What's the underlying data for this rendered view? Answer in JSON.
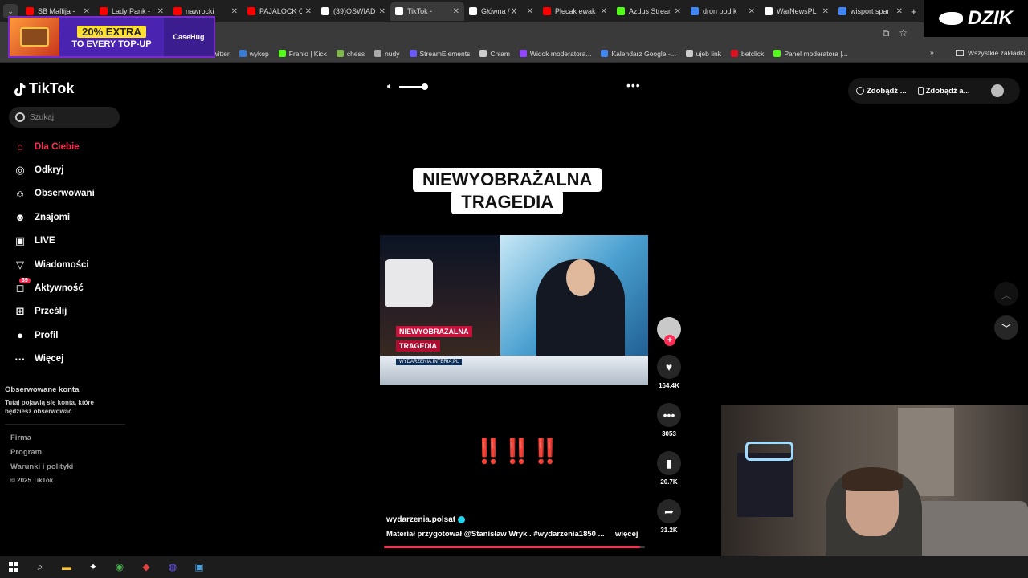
{
  "browser": {
    "tabs": [
      {
        "title": "SB Maffija -",
        "color": "#ff0000",
        "active": false
      },
      {
        "title": "Lady Pank -",
        "color": "#ff0000",
        "active": false
      },
      {
        "title": "nawrocki",
        "color": "#ff0000",
        "active": false
      },
      {
        "title": "PAJALOCK C",
        "color": "#ff0000",
        "active": false
      },
      {
        "title": "(39)OSWIAD",
        "color": "#ffffff",
        "active": false
      },
      {
        "title": "TikTok -",
        "color": "#ffffff",
        "active": true
      },
      {
        "title": "Główna / X",
        "color": "#ffffff",
        "active": false
      },
      {
        "title": "Plecak ewak",
        "color": "#ff0000",
        "active": false
      },
      {
        "title": "Azdus Strear",
        "color": "#53fc18",
        "active": false
      },
      {
        "title": "dron pod k",
        "color": "#4285f4",
        "active": false
      },
      {
        "title": "WarNewsPL",
        "color": "#ffffff",
        "active": false
      },
      {
        "title": "wisport spar",
        "color": "#4285f4",
        "active": false
      }
    ],
    "bookmarks": [
      {
        "label": "twitter",
        "color": "#ffffff"
      },
      {
        "label": "wykop",
        "color": "#3a7bd5"
      },
      {
        "label": "Franio | Kick",
        "color": "#53fc18"
      },
      {
        "label": "chess",
        "color": "#81b64c"
      },
      {
        "label": "nudy",
        "color": "#aaaaaa"
      },
      {
        "label": "StreamElements",
        "color": "#6a5af9"
      },
      {
        "label": "Chłam",
        "color": "#cccccc"
      },
      {
        "label": "Widok moderatora...",
        "color": "#9146ff"
      },
      {
        "label": "Kalendarz Google -...",
        "color": "#4285f4"
      },
      {
        "label": "ujeb link",
        "color": "#cccccc"
      },
      {
        "label": "betclick",
        "color": "#e01020"
      },
      {
        "label": "Panel moderatora |...",
        "color": "#53fc18"
      }
    ],
    "bookmarks_more": "»",
    "all_bookmarks": "Wszystkie zakładki"
  },
  "ad": {
    "extra": "20% EXTRA",
    "topup": "TO EVERY TOP-UP",
    "brand": "CaseHug"
  },
  "overlay": {
    "logo": "DZIK"
  },
  "tiktok": {
    "logo": "TikTok",
    "search_placeholder": "Szukaj",
    "nav": [
      {
        "label": "Dla Ciebie",
        "icon": "home-icon",
        "glyph": "⌂",
        "active": true
      },
      {
        "label": "Odkryj",
        "icon": "compass-icon",
        "glyph": "◎",
        "active": false
      },
      {
        "label": "Obserwowani",
        "icon": "user-follow-icon",
        "glyph": "☺",
        "active": false
      },
      {
        "label": "Znajomi",
        "icon": "friends-icon",
        "glyph": "☻",
        "active": false
      },
      {
        "label": "LIVE",
        "icon": "live-icon",
        "glyph": "▣",
        "active": false
      },
      {
        "label": "Wiadomości",
        "icon": "messages-icon",
        "glyph": "▽",
        "active": false
      },
      {
        "label": "Aktywność",
        "icon": "activity-icon",
        "glyph": "◻",
        "active": false,
        "badge": "39"
      },
      {
        "label": "Prześlij",
        "icon": "upload-icon",
        "glyph": "⊞",
        "active": false
      },
      {
        "label": "Profil",
        "icon": "profile-icon",
        "glyph": "●",
        "active": false
      },
      {
        "label": "Więcej",
        "icon": "more-icon",
        "glyph": "···",
        "active": false
      }
    ],
    "following_title": "Obserwowane konta",
    "following_desc": "Tutaj pojawią się konta, które będziesz obserwować",
    "footer": [
      "Firma",
      "Program",
      "Warunki i polityki"
    ],
    "copyright": "© 2025 TikTok",
    "top_buttons": [
      "Zdobądź ...",
      "Zdobądź a..."
    ]
  },
  "video": {
    "headline_1": "NIEWYOBRAŻALNA",
    "headline_2": "TRAGEDIA",
    "chyron_1": "NIEWYOBRAŻALNA",
    "chyron_2": "TRAGEDIA",
    "chyron_site": "WYDARZENIA.INTERIA.PL",
    "exclamation": "‼️‼️‼️",
    "author": "wydarzenia.polsat",
    "caption": "Materiał przygotował @Stanisław Wryk . #wydarzenia1850 ...",
    "more": "więcej",
    "progress": 0.98,
    "likes": "164.4K",
    "comments": "3053",
    "saves": "20.7K",
    "shares": "31.2K"
  }
}
